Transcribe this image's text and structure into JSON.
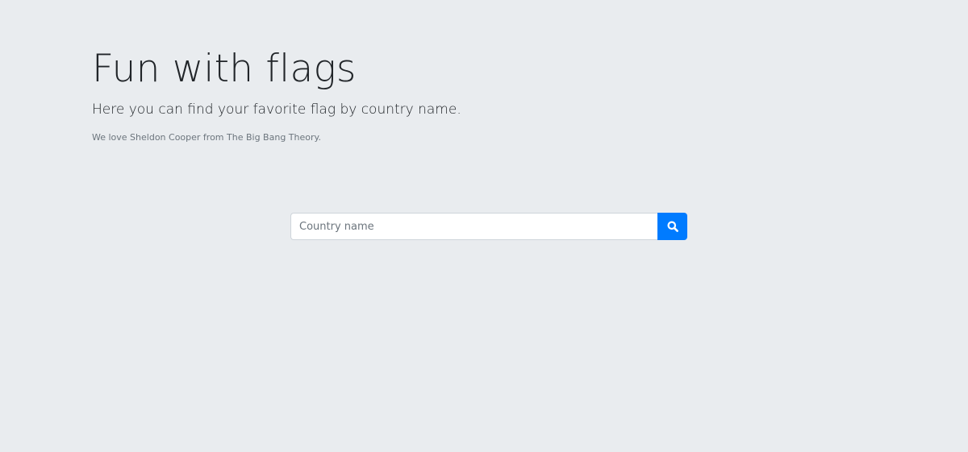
{
  "header": {
    "title": "Fun with flags",
    "lead": "Here you can find your favorite flag by country name.",
    "note": "We love Sheldon Cooper from The Big Bang Theory."
  },
  "search": {
    "placeholder": "Country name",
    "value": "",
    "button_icon": "search-icon"
  },
  "colors": {
    "background": "#e9ecef",
    "accent": "#007bff",
    "text": "#212529",
    "muted": "#6c757d"
  }
}
